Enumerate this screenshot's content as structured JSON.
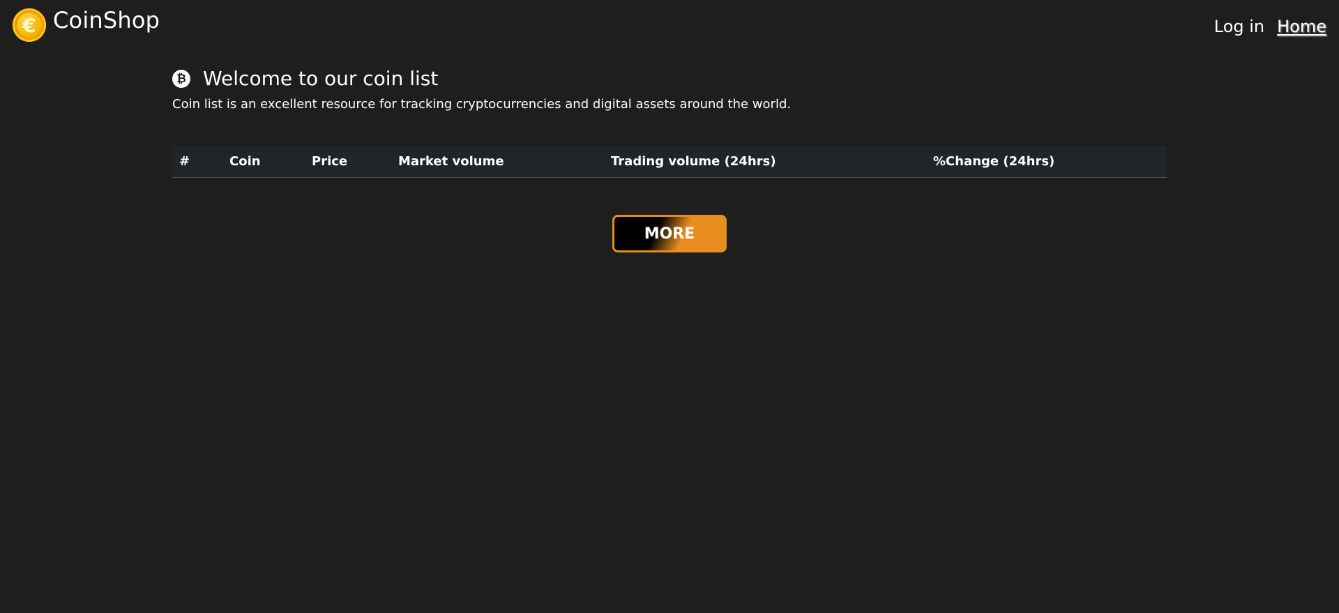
{
  "header": {
    "brand_name": "CoinShop",
    "logo_icon": "euro-coin-icon",
    "logo_glyph": "€",
    "nav": {
      "login_label": "Log in",
      "home_label": "Home"
    }
  },
  "intro": {
    "icon": "bitcoin-icon",
    "icon_glyph": "₿",
    "title": "Welcome to our coin list",
    "subtitle": "Coin list is an excellent resource for tracking cryptocurrencies and digital assets around the world."
  },
  "table": {
    "columns": [
      "#",
      "Coin",
      "Price",
      "Market volume",
      "Trading volume (24hrs)",
      "%Change (24hrs)"
    ],
    "rows": []
  },
  "more_button": {
    "label": "MORE"
  },
  "colors": {
    "background": "#1e1e1e",
    "table_header_bg": "#212529",
    "accent_orange": "#e88d1f",
    "coin_gold": "#f6b300"
  }
}
